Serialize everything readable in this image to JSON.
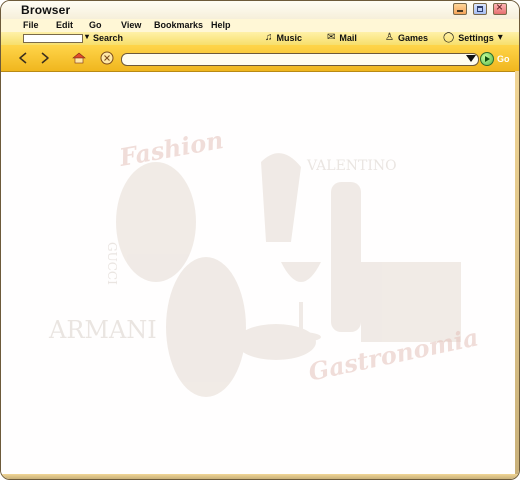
{
  "window": {
    "title": "Browser"
  },
  "menu": [
    "File",
    "Edit",
    "Go",
    "View",
    "Bookmarks",
    "Help"
  ],
  "search": {
    "label": "Search",
    "value": ""
  },
  "toolbar": [
    {
      "label": "Music",
      "icon": "music-icon"
    },
    {
      "label": "Mail",
      "icon": "mail-icon"
    },
    {
      "label": "Games",
      "icon": "games-icon"
    },
    {
      "label": "Settings",
      "icon": "settings-icon"
    }
  ],
  "address": {
    "value": ""
  },
  "go": {
    "label": "Go"
  },
  "watermark": {
    "brand_armani": "ARMANI",
    "brand_valentino": "VALENTINO",
    "brand_gucci": "GUCCI",
    "script_top": "Fashion",
    "script_bottom": "Gastronomia"
  },
  "colors": {
    "menubar_bg": "#fff7d6",
    "searchbar_bg": "#f7df6c",
    "navbar_bg": "#f0b61e",
    "frame": "#6d5a3a"
  }
}
